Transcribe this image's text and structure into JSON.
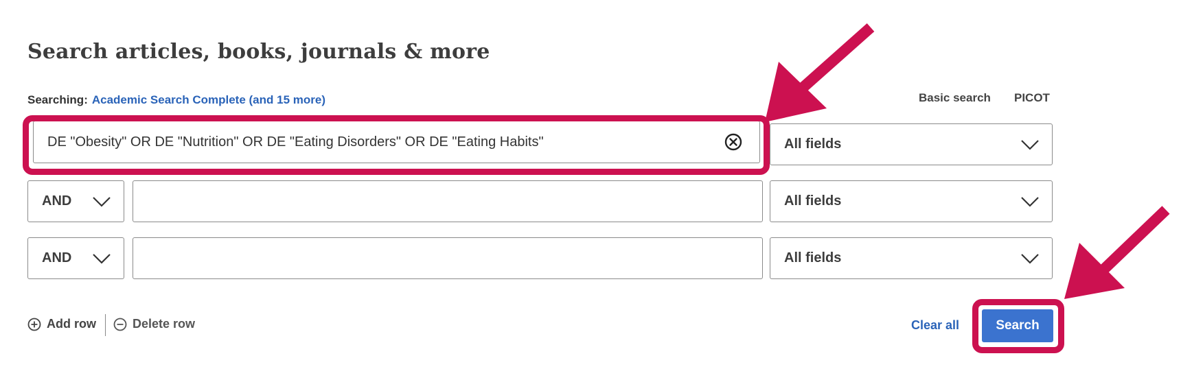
{
  "heading": "Search articles, books, journals & more",
  "searching": {
    "label": "Searching:",
    "databases_link": "Academic Search Complete (and 15 more)"
  },
  "modes": {
    "basic": "Basic search",
    "picot": "PICOT"
  },
  "rows": [
    {
      "query": "DE \"Obesity\" OR DE \"Nutrition\" OR DE \"Eating Disorders\" OR DE \"Eating Habits\"",
      "field": "All fields"
    },
    {
      "operator": "AND",
      "query": "",
      "field": "All fields"
    },
    {
      "operator": "AND",
      "query": "",
      "field": "All fields"
    }
  ],
  "actions": {
    "add_row": "Add row",
    "delete_row": "Delete row",
    "clear_all": "Clear all",
    "search": "Search"
  },
  "colors": {
    "highlight": "#cc1150",
    "primary": "#3b73cf",
    "link": "#2a63b8"
  }
}
